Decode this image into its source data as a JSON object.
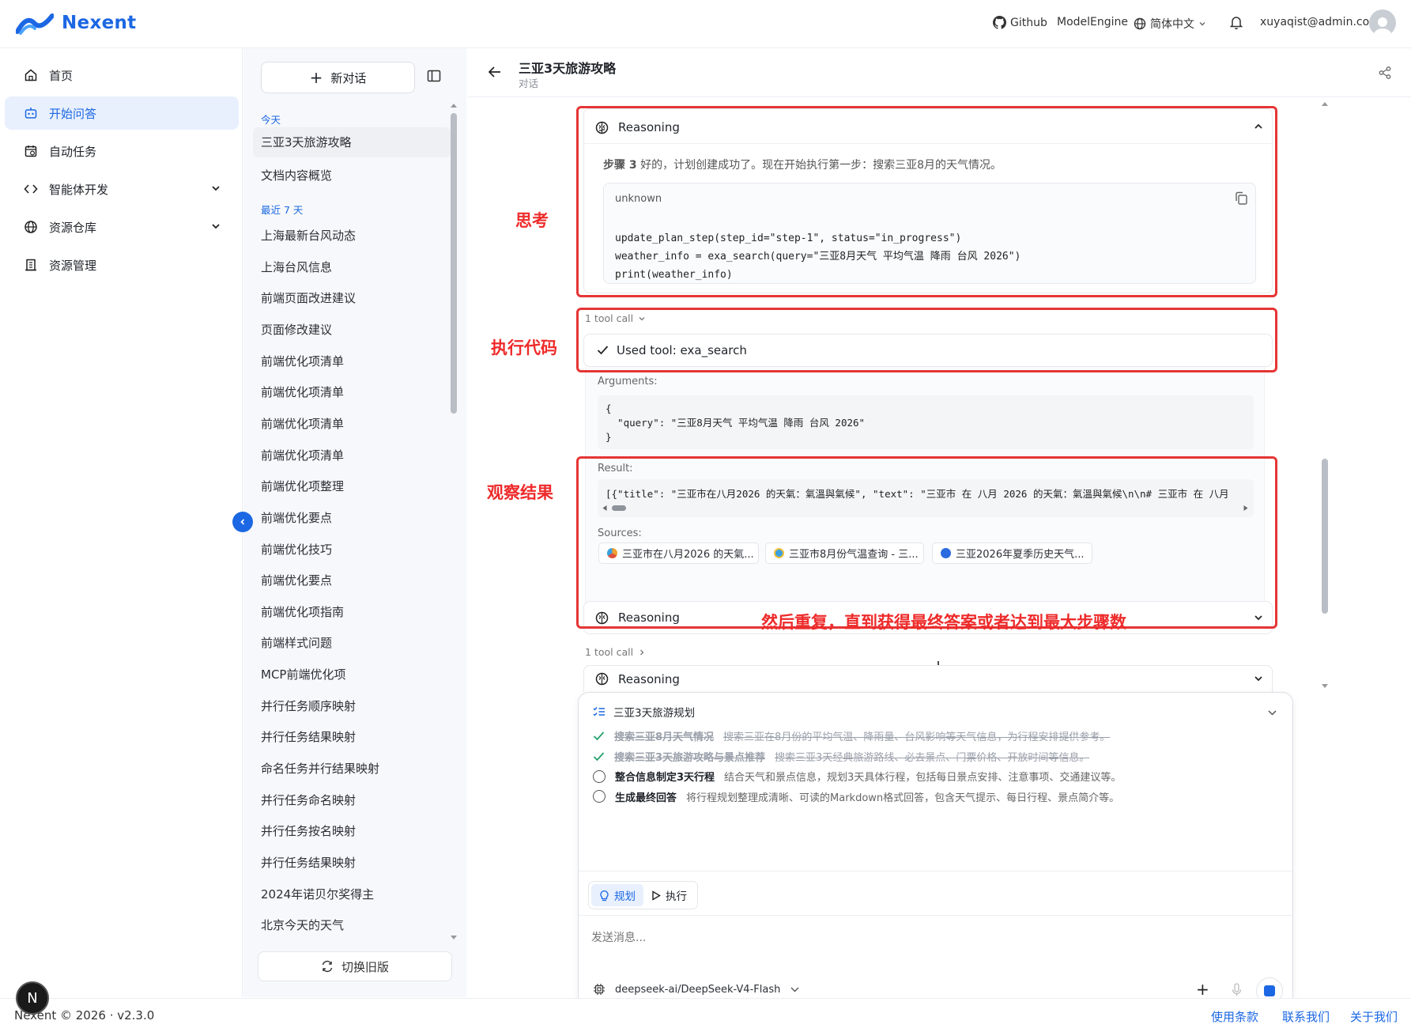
{
  "brand": {
    "name": "Nexent",
    "color": "#1c67e3"
  },
  "header": {
    "github": "Github",
    "model_engine": "ModelEngine",
    "language": "简体中文",
    "user": "xuyaqist@admin.com"
  },
  "sidebar": {
    "items": [
      {
        "label": "首页",
        "icon": "home-icon"
      },
      {
        "label": "开始问答",
        "icon": "robot-icon",
        "active": true
      },
      {
        "label": "自动任务",
        "icon": "calendar-icon"
      },
      {
        "label": "智能体开发",
        "icon": "code-icon"
      },
      {
        "label": "资源仓库",
        "icon": "globe-icon"
      },
      {
        "label": "资源管理",
        "icon": "building-icon"
      }
    ]
  },
  "conversations": {
    "new_chat": "新对话",
    "today_label": "今天",
    "today": [
      "三亚3天旅游攻略",
      "文档内容概览"
    ],
    "recent_label": "最近 7 天",
    "recent": [
      "上海最新台风动态",
      "上海台风信息",
      "前端页面改进建议",
      "页面修改建议",
      "前端优化项清单",
      "前端优化项清单",
      "前端优化项清单",
      "前端优化项清单",
      "前端优化项整理",
      "前端优化要点",
      "前端优化技巧",
      "前端优化要点",
      "前端优化项指南",
      "前端样式问题",
      "MCP前端优化项",
      "并行任务顺序映射",
      "并行任务结果映射",
      "命名任务并行结果映射",
      "并行任务命名映射",
      "并行任务按名映射",
      "并行任务结果映射",
      "2024年诺贝尔奖得主",
      "北京今天的天气"
    ],
    "switch_old": "切换旧版"
  },
  "main": {
    "title": "三亚3天旅游攻略",
    "subtitle": "对话",
    "reasoning_label": "Reasoning",
    "step_prefix": "步骤 3",
    "step_text": " 好的，计划创建成功了。现在开始执行第一步：搜索三亚8月的天气情况。",
    "code_lang": "unknown",
    "code_lines": [
      "update_plan_step(step_id=\"step-1\", status=\"in_progress\")",
      "weather_info = exa_search(query=\"三亚8月天气 平均气温 降雨 台风 2026\")",
      "print(weather_info)"
    ],
    "tool_call_count": "1 tool call",
    "used_tool": "Used tool: exa_search",
    "arguments_label": "Arguments:",
    "arguments_lines": [
      "{",
      "  \"query\": \"三亚8月天气 平均气温 降雨 台风 2026\"",
      "}"
    ],
    "result_label": "Result:",
    "result_text": "[{\"title\": \"三亚市在八月2026 的天氣：氣溫與氣候\", \"text\": \"三亚市 在 八月 2026 的天氣：氣溫與氣候\\n\\n# 三亚市 在 八月",
    "sources_label": "Sources:",
    "sources": [
      {
        "label": "三亚市在八月2026 的天氣...",
        "color": "#f0a030"
      },
      {
        "label": "三亚市8月份气温查询 - 三...",
        "color": "#3aa0e0"
      },
      {
        "label": "三亚2026年夏季历史天气...",
        "color": "#2a6be0"
      }
    ]
  },
  "annotations": {
    "think": "思考",
    "exec": "执行代码",
    "observe": "观察结果",
    "repeat": "然后重复，直到获得最终答案或者达到最大步骤数"
  },
  "plan": {
    "title": "三亚3天旅游规划",
    "steps": [
      {
        "title": "搜索三亚8月天气情况",
        "desc": "搜索三亚在8月份的平均气温、降雨量、台风影响等天气信息，为行程安排提供参考。",
        "done": true
      },
      {
        "title": "搜索三亚3天旅游攻略与景点推荐",
        "desc": "搜索三亚3天经典旅游路线、必去景点、门票价格、开放时间等信息。",
        "done": true
      },
      {
        "title": "整合信息制定3天行程",
        "desc": "结合天气和景点信息，规划3天具体行程，包括每日景点安排、注意事项、交通建议等。",
        "done": false
      },
      {
        "title": "生成最终回答",
        "desc": "将行程规划整理成清晰、可读的Markdown格式回答，包含天气提示、每日行程、景点简介等。",
        "done": false
      }
    ]
  },
  "composer": {
    "mode_plan": "规划",
    "mode_exec": "执行",
    "placeholder": "发送消息...",
    "model": "deepseek-ai/DeepSeek-V4-Flash"
  },
  "footer": {
    "copyright": "Nexent © 2026 · v2.3.0",
    "terms": "使用条款",
    "contact": "联系我们",
    "about": "关于我们"
  },
  "colors": {
    "accent": "#1c67e3",
    "annotation_red": "#e53535",
    "check_green": "#22a06b"
  }
}
